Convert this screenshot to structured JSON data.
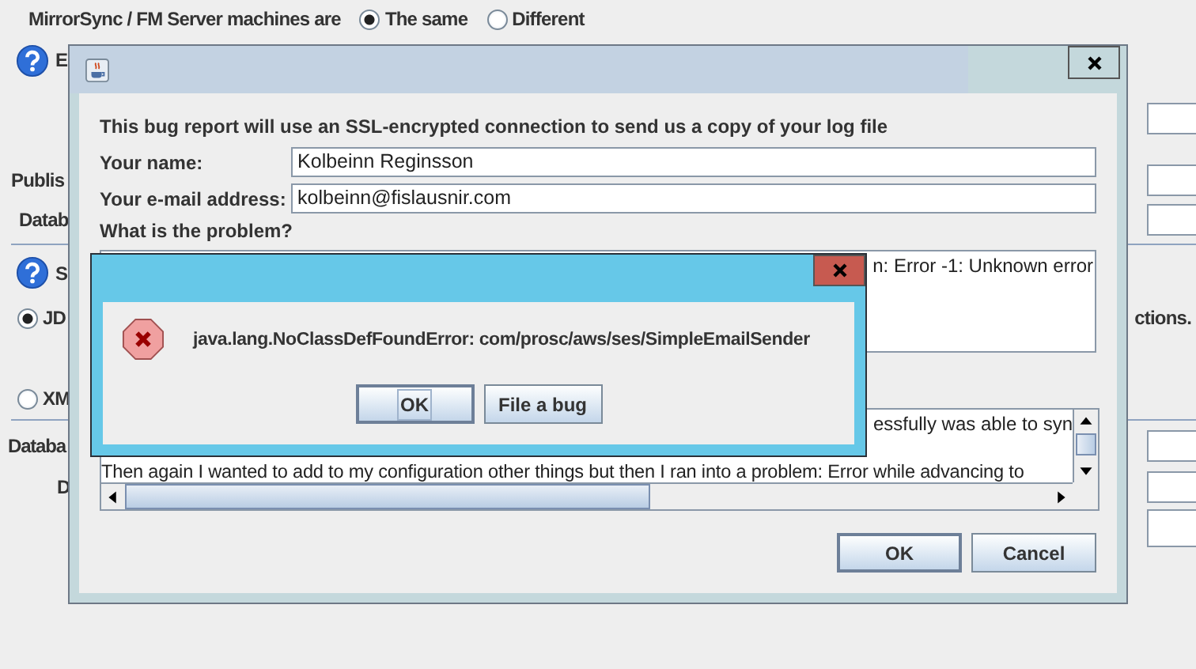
{
  "background": {
    "machines_label": "MirrorSync / FM Server machines are",
    "machine_options": [
      {
        "label": "The same",
        "selected": true
      },
      {
        "label": "Different",
        "selected": false
      }
    ],
    "section_1_label": "E",
    "publish_label": "Publis",
    "database_label": "Datab",
    "section_2_label": "S",
    "mode_options": [
      {
        "label": "JD",
        "selected": true
      },
      {
        "label": "XM",
        "selected": false
      }
    ],
    "mode_note": "ctions.",
    "database_label_2": "Databa",
    "field_label": "D"
  },
  "bug_report": {
    "intro": "This bug report will use an SSL-encrypted connection to send us a copy of your log file",
    "name_label": "Your name:",
    "name_value": "Kolbeinn Reginsson",
    "email_label": "Your e-mail address:",
    "email_value": "kolbeinn@fislausnir.com",
    "problem_label": "What is the problem?",
    "problem_text": "n: Error -1: Unknown error",
    "log_lines": [
      "essfully was able to syn",
      "Then again I wanted to add to my configuration other things but then I ran into a problem:  Error while advancing to"
    ],
    "buttons": [
      {
        "label": "OK",
        "focused": true
      },
      {
        "label": "Cancel",
        "focused": false
      }
    ]
  },
  "error_dialog": {
    "message": "java.lang.NoClassDefFoundError: com/prosc/aws/ses/SimpleEmailSender",
    "buttons": [
      {
        "label": "OK",
        "focused": true
      },
      {
        "label": "File a bug",
        "focused": false
      }
    ]
  }
}
